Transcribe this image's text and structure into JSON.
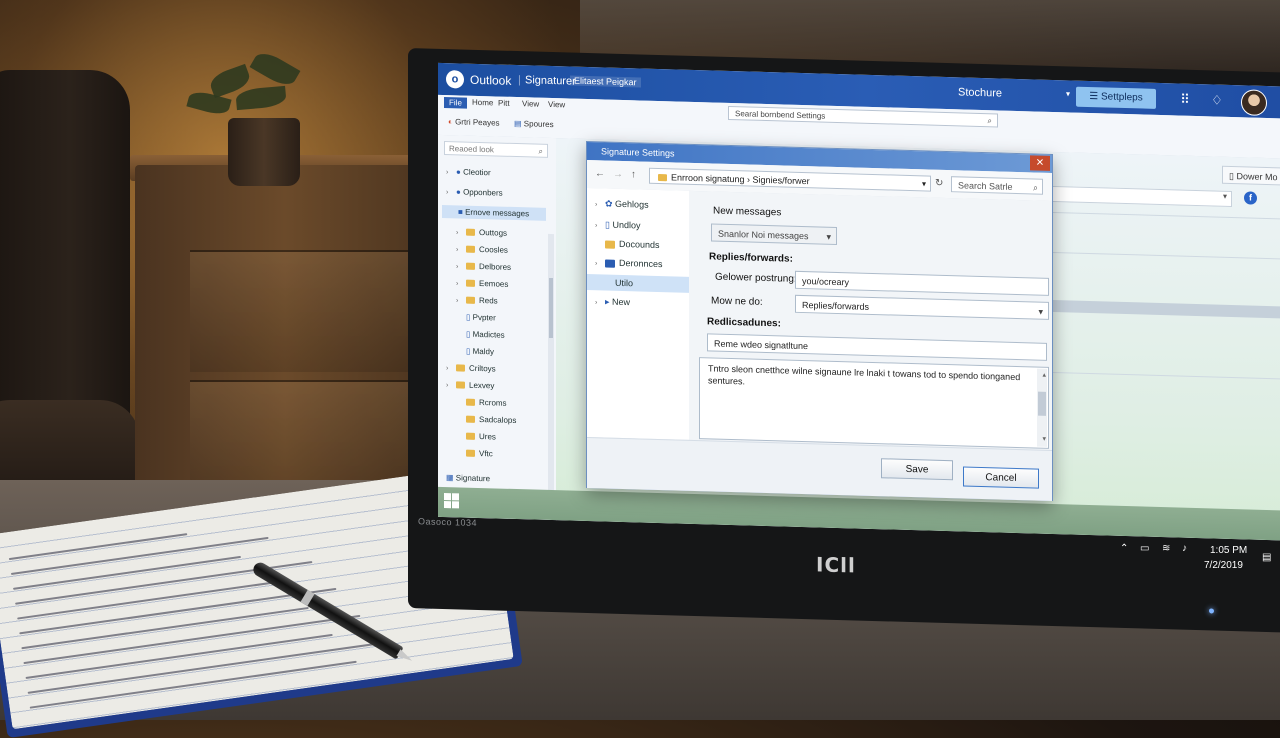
{
  "titlebar": {
    "app": "Outlook",
    "breadcrumb": "Signaturer",
    "tab": "Elitaest Peigkar",
    "center": "Stochure",
    "action": "Settpleps"
  },
  "ribbon": {
    "tabs": [
      "File",
      "Home",
      "Pitt",
      "View",
      "View"
    ],
    "search": "Searal bornbend Settings",
    "row2": [
      "Grtri Peayes",
      "Spoures"
    ]
  },
  "nav": {
    "search": "Reaoed look",
    "items": [
      "Cleotior",
      "Opponbers",
      "Ernove messages",
      "Outtogs",
      "Coosles",
      "Delbores",
      "Eemoes",
      "Reds",
      "Pvpter",
      "Madictes",
      "Maldy",
      "Criltoys",
      "Lexvey",
      "Rcroms",
      "Sadcalops",
      "Ures",
      "Vftc"
    ],
    "bottom": "Signature"
  },
  "content": {
    "button": "Dower Mo"
  },
  "dialog": {
    "title": "Signature Settings",
    "address": "Enrroon signatung  ›  Signies/forwer",
    "search": "Search Satrle",
    "tree": [
      "Gehlogs",
      "Undloy",
      "Docounds",
      "Deronnces",
      "Utilo",
      "New"
    ],
    "new_messages_label": "New messages",
    "new_messages_value": "Snanlor Noi messages",
    "replies_label": "Replies/forwards:",
    "field1_label": "Gelower postrung:",
    "field1_value": "you/ocreary",
    "field2_label": "Mow ne do:",
    "field2_value": "Replies/forwards",
    "section_label": "Redlicsadunes:",
    "name_value": "Reme wdeo signatltune",
    "body_text": "Tntro sleon cnetthce wilne signaune lre lnaki t towans tod to spendo tionganed sentures.",
    "save": "Save",
    "cancel": "Cancel"
  },
  "taskbar": {
    "time": "1:05 PM",
    "date": "7/2/2019"
  },
  "monitor": {
    "bezel_label": "Oasoco 1034",
    "brand": "ICll"
  }
}
